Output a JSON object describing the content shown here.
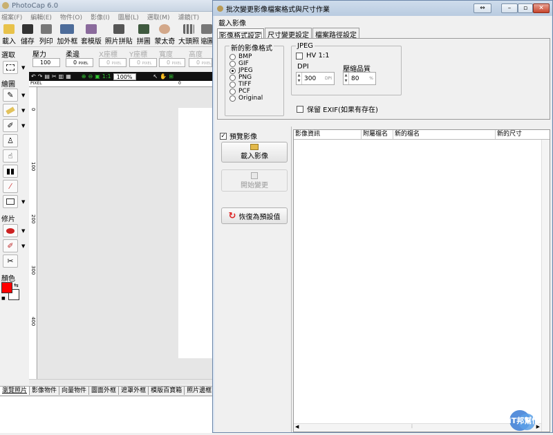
{
  "main": {
    "title": "PhotoCap 6.0",
    "menu": [
      "檔案(F)",
      "編輯(E)",
      "物件(O)",
      "影像(I)",
      "圖層(L)",
      "選取(M)",
      "濾鏡(T)"
    ],
    "toolbar": [
      {
        "label": "載入",
        "icon": "open-folder-icon"
      },
      {
        "label": "儲存",
        "icon": "save-icon"
      },
      {
        "label": "列印",
        "icon": "printer-icon"
      },
      {
        "label": "加外框",
        "icon": "frame-icon"
      },
      {
        "label": "套模版",
        "icon": "template-icon"
      },
      {
        "label": "照片拼貼",
        "icon": "collage-icon"
      },
      {
        "label": "拼圖",
        "icon": "puzzle-icon"
      },
      {
        "label": "蒙太奇",
        "icon": "montage-icon"
      },
      {
        "label": "大頭照",
        "icon": "id-photo-icon"
      },
      {
        "label": "縮圖",
        "icon": "thumbnail-icon"
      }
    ],
    "props": {
      "pressure_label": "壓力",
      "pressure_value": "100",
      "softness_label": "柔邊",
      "softness_value": "0",
      "softness_unit": "PIXEL",
      "x_label": "X座標",
      "x_value": "0",
      "y_label": "Y座標",
      "y_value": "0",
      "width_label": "寬度",
      "width_value": "0",
      "height_label": "高度",
      "height_value": "0",
      "unit": "PIXEL"
    },
    "tool_sections": {
      "select": "選取",
      "draw": "繪圖",
      "retouch": "修片",
      "color": "顏色"
    },
    "foreground_color": "#ff0000",
    "background_color": "#ffffff",
    "zoom": "100%",
    "ruler_unit": "PIXEL",
    "ruler_top_zero": "0",
    "ruler_left_marks": [
      "0",
      "100",
      "200",
      "300",
      "400"
    ],
    "bottom_tabs": [
      "瀏覽照片",
      "影像物件",
      "向量物件",
      "圖面外框",
      "遮罩外框",
      "模版百寶箱",
      "照片邊框"
    ]
  },
  "dialog": {
    "title": "批次變更影像檔案格式與尺寸作業",
    "menu": "載入影像",
    "tabs": [
      "影像格式設定",
      "尺寸變更設定",
      "檔案路徑設定"
    ],
    "format_group": {
      "caption": "新的影像格式",
      "options": [
        "BMP",
        "GIF",
        "JPEG",
        "PNG",
        "TIFF",
        "PCF",
        "Original"
      ],
      "selected": "JPEG"
    },
    "jpeg_group": {
      "caption": "JPEG",
      "hv_label": "HV 1:1",
      "dpi_label": "DPI",
      "dpi_value": "300",
      "dpi_unit": "DPI",
      "quality_label": "壓縮品質",
      "quality_value": "80",
      "quality_unit": "%",
      "keep_exif_label": "保留 EXIF(如果有存在)"
    },
    "preview_label": "預覽影像",
    "preview_checked": true,
    "load_button": "載入影像",
    "start_button": "開始變更",
    "reset_button": "恢復為預設值",
    "columns": [
      "影像資訊",
      "附屬檔名",
      "新的檔名",
      "新的尺寸"
    ]
  },
  "watermark": {
    "text": "iT邦幫忙"
  }
}
